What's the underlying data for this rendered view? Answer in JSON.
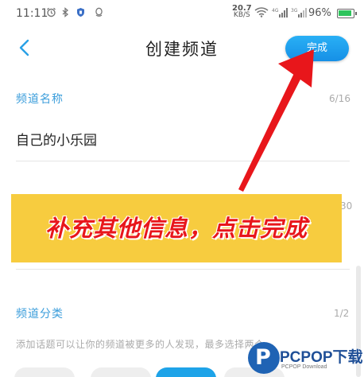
{
  "status_bar": {
    "time": "11:11",
    "net_speed_value": "20.7",
    "net_speed_unit": "KB/S",
    "sim1": "4G",
    "sim2": "3G",
    "battery": "96%"
  },
  "header": {
    "back_icon": "chevron-left-icon",
    "title": "创建频道",
    "done_label": "完成"
  },
  "channel_name": {
    "label": "频道名称",
    "counter": "6/16",
    "value": "自己的小乐园"
  },
  "description": {
    "counter_partial": "30"
  },
  "channel_category": {
    "label": "频道分类",
    "counter": "1/2",
    "tip": "添加话题可以让你的频道被更多的人发现，最多选择两个"
  },
  "annotation": {
    "banner_text": "补充其他信息，点击完成"
  },
  "watermark": {
    "logo_letter": "P",
    "brand": "PCPOP下载",
    "sub": "PCPOP Download"
  },
  "colors": {
    "accent": "#1da1f2",
    "label_blue": "#3c9edb",
    "banner_yellow": "#f7cc3f",
    "annotation_red": "#e8161b"
  }
}
